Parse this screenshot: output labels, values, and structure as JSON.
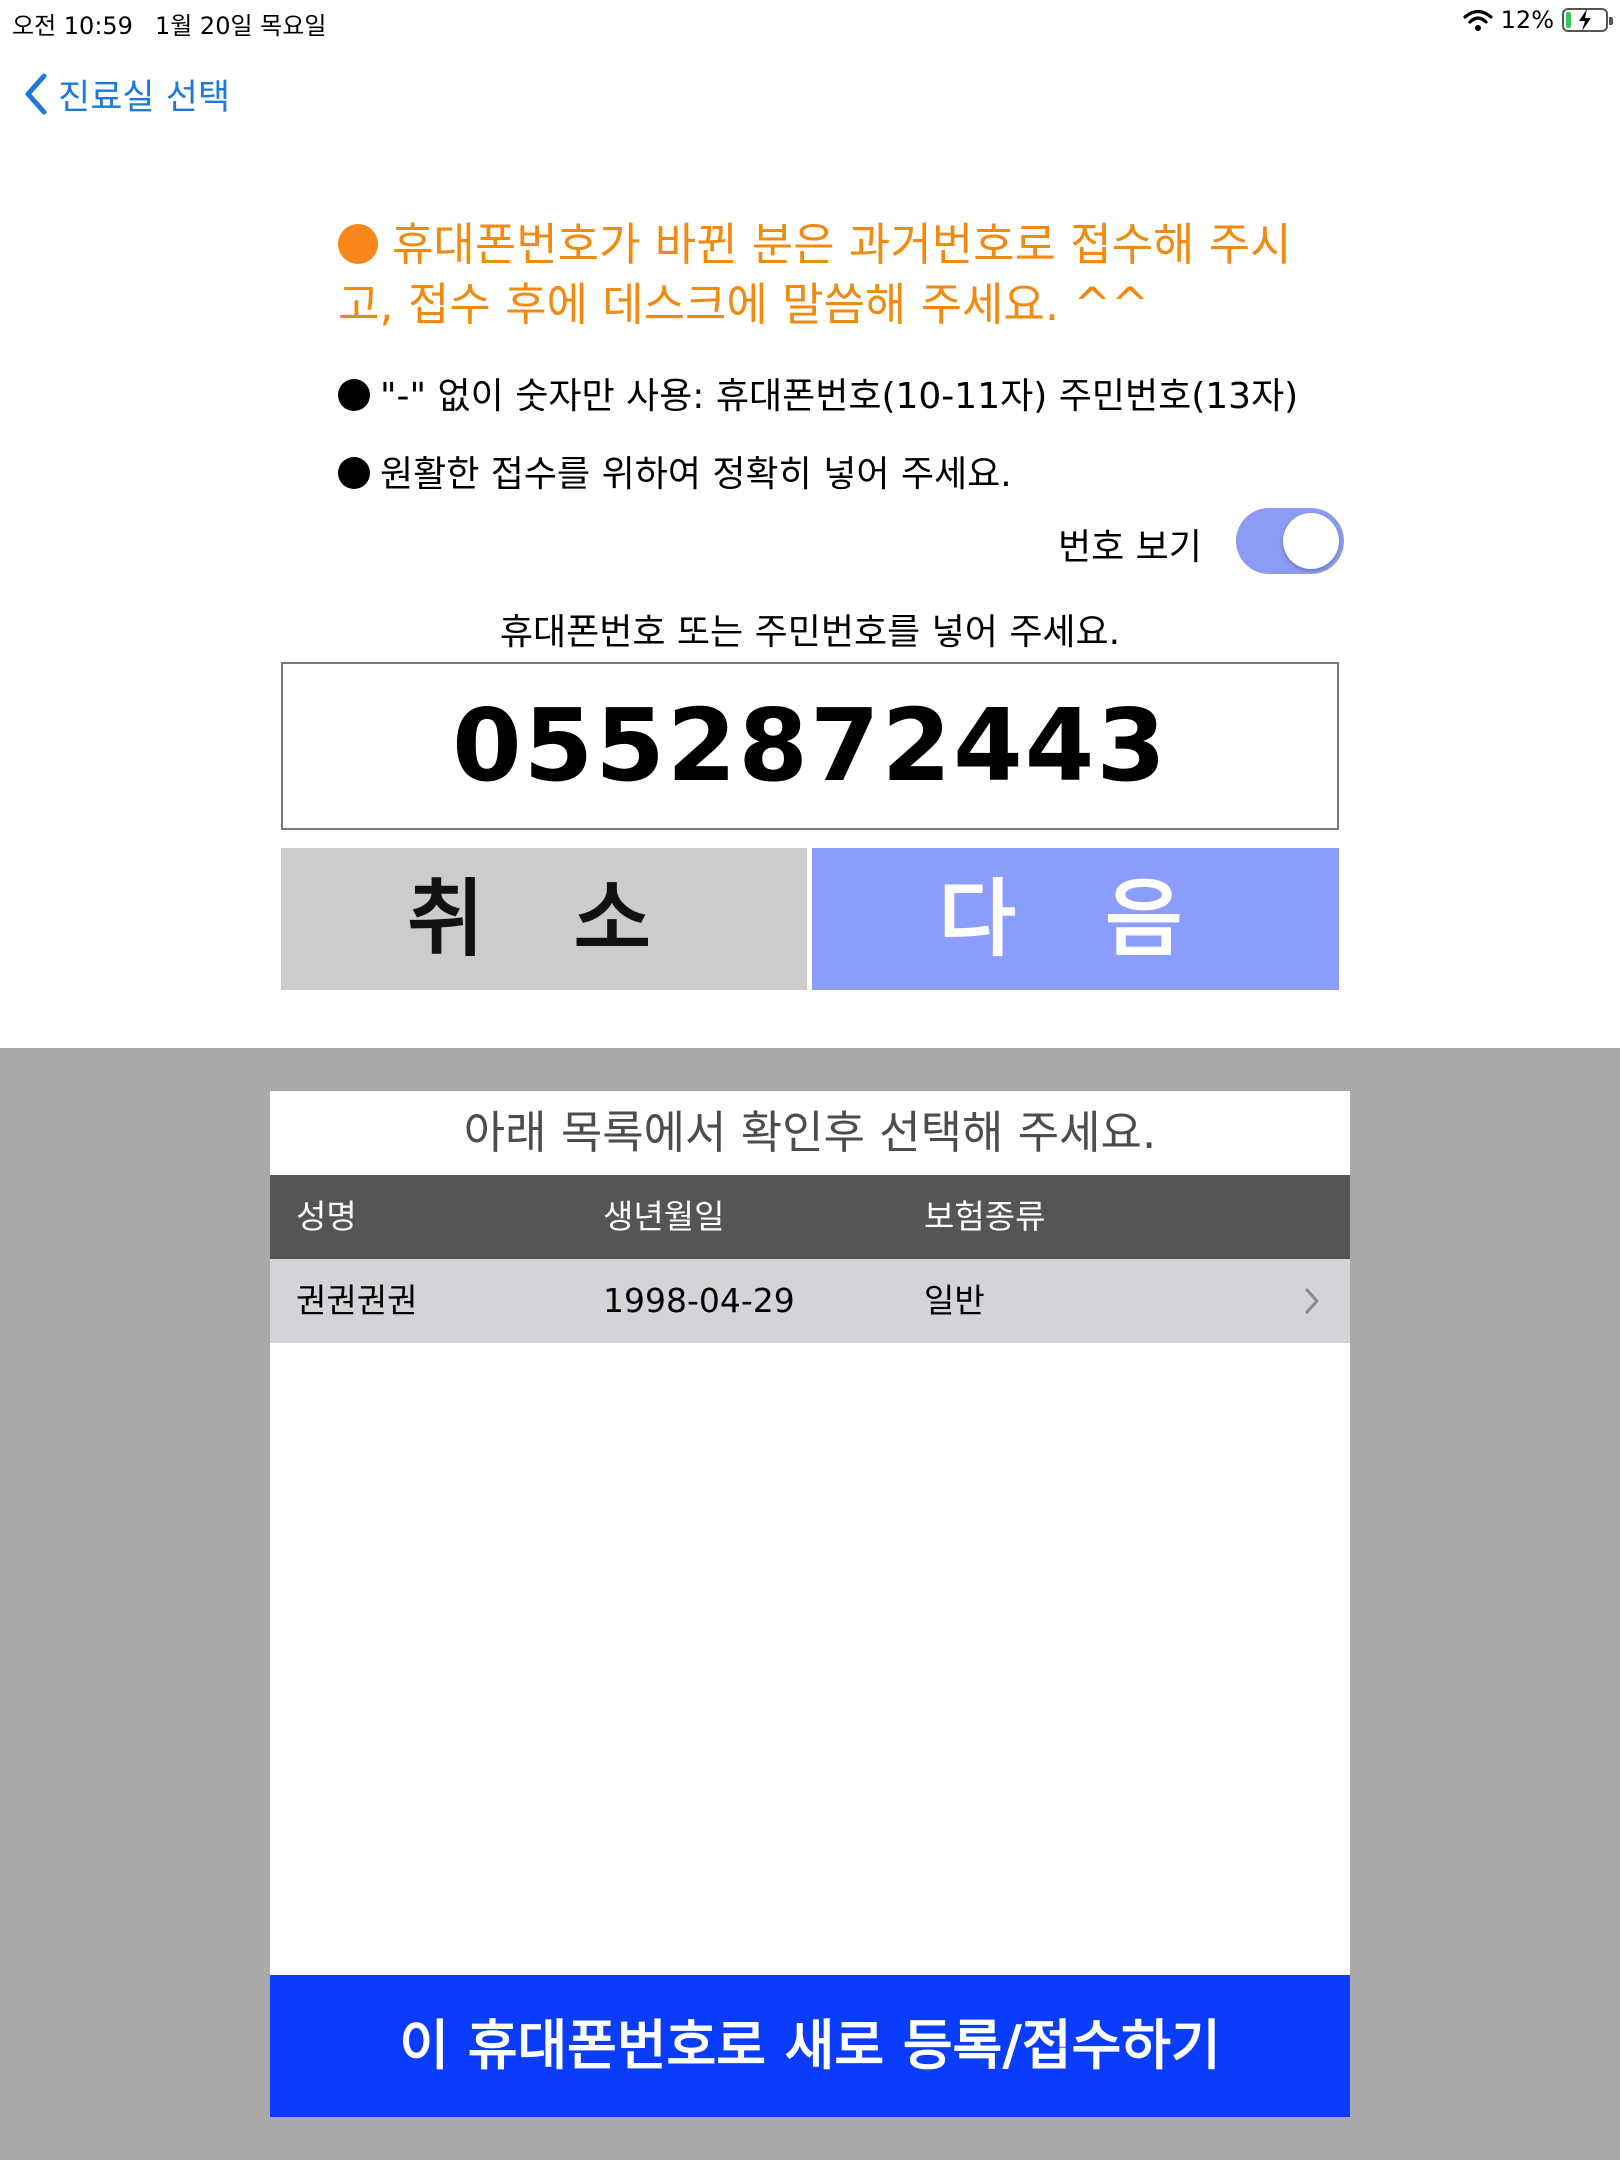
{
  "status_bar": {
    "time": "오전 10:59",
    "date": "1월 20일 목요일",
    "battery_text": "12%",
    "battery_level": 0.12
  },
  "nav": {
    "back_label": "진료실 선택"
  },
  "notices": {
    "orange": "휴대폰번호가 바뀐 분은 과거번호로 접수해 주시고, 접수 후에 데스크에 말씀해 주세요. ^^",
    "line1": "\"-\" 없이 숫자만 사용: 휴대폰번호(10-11자) 주민번호(13자)",
    "line2": "원활한 접수를 위하여 정확히 넣어 주세요."
  },
  "toggle": {
    "label": "번호 보기",
    "on": true
  },
  "input": {
    "label": "휴대폰번호 또는 주민번호를 넣어 주세요.",
    "value": "0552872443"
  },
  "buttons": {
    "cancel": "취 소",
    "next": "다 음",
    "register": "이 휴대폰번호로 새로 등록/접수하기"
  },
  "list": {
    "title": "아래 목록에서 확인후 선택해 주세요.",
    "columns": [
      "성명",
      "생년월일",
      "보험종류"
    ],
    "rows": [
      {
        "name": "권권권권",
        "birth": "1998-04-29",
        "insurance": "일반"
      }
    ]
  },
  "colors": {
    "accent_blue": "#1e7ad8",
    "orange": "#f08a10",
    "next_button": "#8c9efc",
    "register_button": "#0a3cfc"
  }
}
